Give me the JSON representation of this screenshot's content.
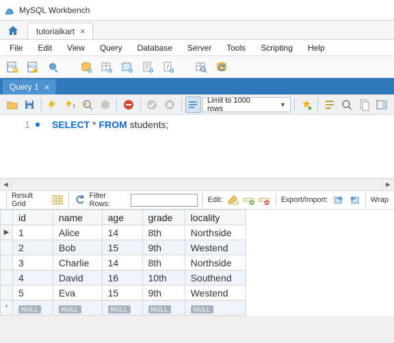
{
  "window": {
    "title": "MySQL Workbench"
  },
  "connection_tab": {
    "name": "tutorialkart"
  },
  "menu": {
    "file": "File",
    "edit": "Edit",
    "view": "View",
    "query": "Query",
    "database": "Database",
    "server": "Server",
    "tools": "Tools",
    "scripting": "Scripting",
    "help": "Help"
  },
  "query_tab": {
    "label": "Query 1"
  },
  "editor": {
    "line_num": "1",
    "sql_select": "SELECT",
    "sql_star": "*",
    "sql_from": "FROM",
    "sql_table": "students;",
    "limit_label": "Limit to 1000 rows"
  },
  "result_toolbar": {
    "grid_label": "Result Grid",
    "filter_label": "Filter Rows:",
    "filter_value": "",
    "edit_label": "Edit:",
    "export_label": "Export/Import:",
    "wrap_label": "Wrap"
  },
  "grid": {
    "columns": [
      "id",
      "name",
      "age",
      "grade",
      "locality"
    ],
    "rows": [
      [
        "1",
        "Alice",
        "14",
        "8th",
        "Northside"
      ],
      [
        "2",
        "Bob",
        "15",
        "9th",
        "Westend"
      ],
      [
        "3",
        "Charlie",
        "14",
        "8th",
        "Northside"
      ],
      [
        "4",
        "David",
        "16",
        "10th",
        "Southend"
      ],
      [
        "5",
        "Eva",
        "15",
        "9th",
        "Westend"
      ]
    ],
    "null_label": "NULL"
  }
}
